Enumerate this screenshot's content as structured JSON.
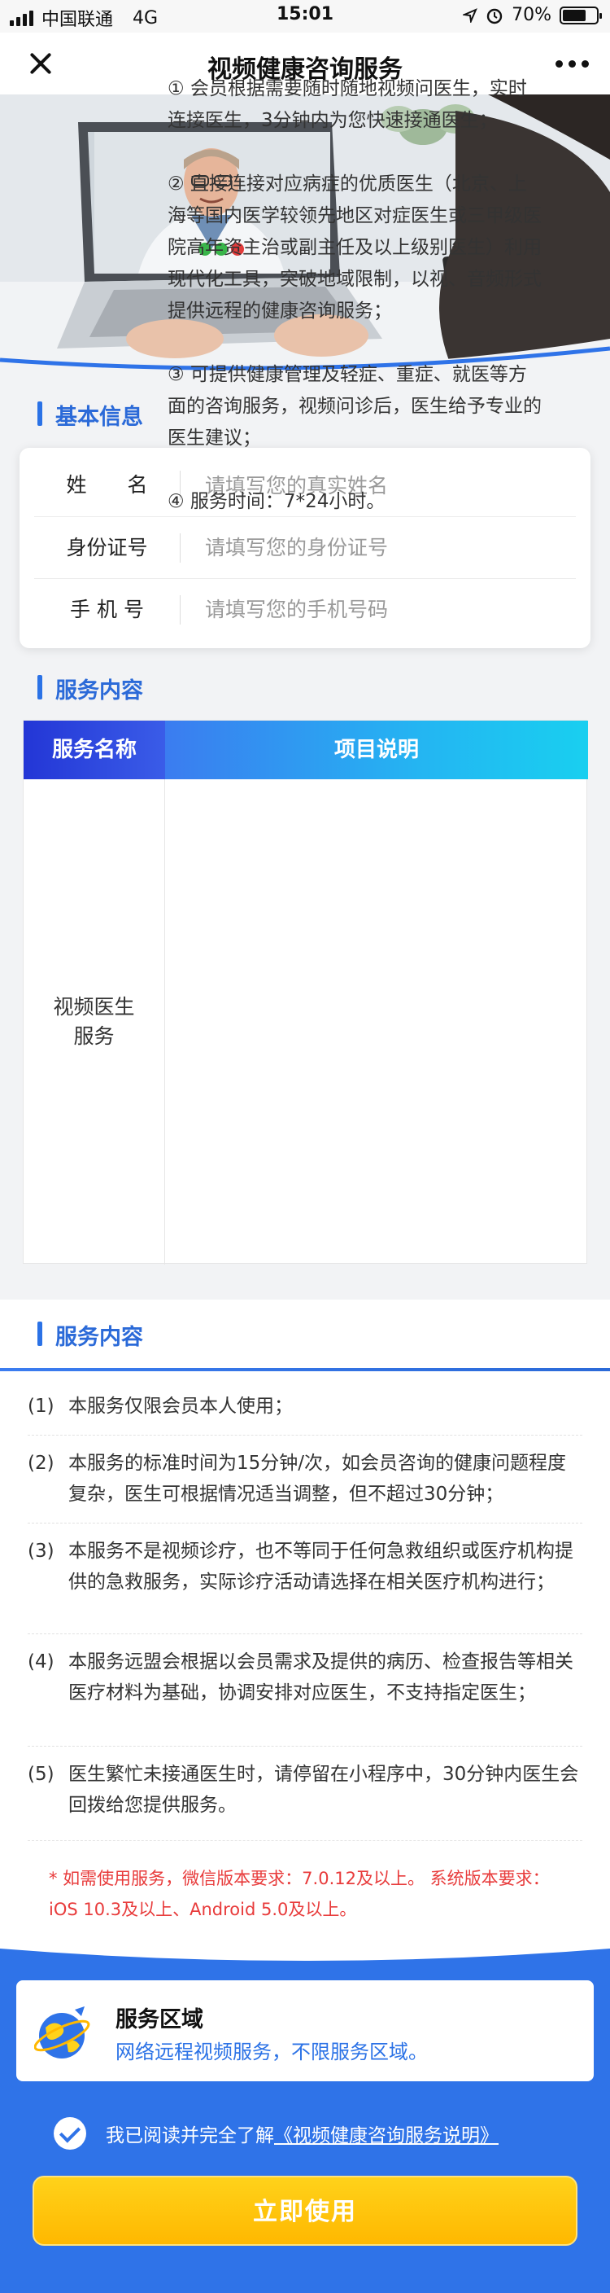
{
  "status_bar": {
    "carrier": "中国联通",
    "network": "4G",
    "time": "15:01",
    "battery": "70%",
    "battery_level": 0.7
  },
  "nav": {
    "title": "视频健康咨询服务"
  },
  "basic_info": {
    "title": "基本信息",
    "fields": [
      {
        "label": "姓　　名",
        "placeholder": "请填写您的真实姓名",
        "value": ""
      },
      {
        "label": "身份证号",
        "placeholder": "请填写您的身份证号",
        "value": ""
      },
      {
        "label": "手 机 号",
        "placeholder": "请填写您的手机号码",
        "value": ""
      }
    ]
  },
  "service_content": {
    "title": "服务内容",
    "headers": [
      "服务名称",
      "项目说明"
    ],
    "name_line1": "视频医生",
    "name_line2": "服务",
    "items": [
      "① 会员根据需要随时随地视频问医生，实时连接医生，3分钟内为您快速接通医生；",
      "② 直接连接对应病症的优质医生（北京、上海等国内医学较领先地区对症医生或三甲级医院高年资主治或副主任及以上级别医生）利用现代化工具，突破地域限制，以视、音频形式提供远程的健康咨询服务；",
      "③ 可提供健康管理及轻症、重症、就医等方面的咨询服务，视频问诊后，医生给予专业的医生建议；",
      "④ 服务时间：7*24小时。"
    ]
  },
  "notes": {
    "title": "服务内容",
    "items": [
      {
        "num": "(1)",
        "text": "本服务仅限会员本人使用；"
      },
      {
        "num": "(2)",
        "text": "本服务的标准时间为15分钟/次，如会员咨询的健康问题程度复杂，医生可根据情况适当调整，但不超过30分钟；"
      },
      {
        "num": "(3)",
        "text": "本服务不是视频诊疗，也不等同于任何急救组织或医疗机构提供的急救服务，实际诊疗活动请选择在相关医疗机构进行；"
      },
      {
        "num": "(4)",
        "text": "本服务远盟会根据以会员需求及提供的病历、检查报告等相关医疗材料为基础，协调安排对应医生，不支持指定医生；"
      },
      {
        "num": "(5)",
        "text": "医生繁忙未接通医生时，请停留在小程序中，30分钟内医生会回拨给您提供服务。"
      }
    ],
    "warning": "* 如需使用服务，微信版本要求：7.0.12及以上。 系统版本要求：iOS 10.3及以上、Android 5.0及以上。"
  },
  "region": {
    "title": "服务区域",
    "desc": "网络远程视频服务，不限服务区域。"
  },
  "agreement": {
    "prefix": "我已阅读并完全了解",
    "link": "《视频健康咨询服务说明》",
    "checked": true
  },
  "cta": {
    "label": "立即使用"
  },
  "colors": {
    "primary": "#2f73e8",
    "accent": "#ffc107",
    "warning": "#e83b3b"
  }
}
